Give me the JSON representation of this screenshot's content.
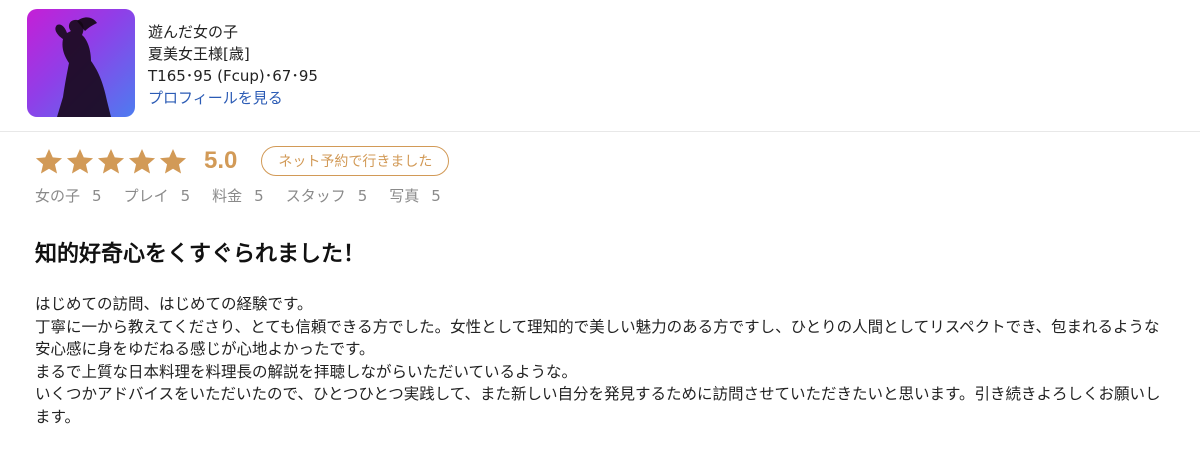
{
  "profile": {
    "caption": "遊んだ女の子",
    "name": "夏美女王様[歳]",
    "measurements": "T165･95 (Fcup)･67･95",
    "profile_link": "プロフィールを見る"
  },
  "rating": {
    "stars": 5,
    "score": "5.0",
    "badge": "ネット予約で行きました",
    "star_color": "#d29a57",
    "categories": [
      {
        "label": "女の子",
        "value": "5"
      },
      {
        "label": "プレイ",
        "value": "5"
      },
      {
        "label": "料金",
        "value": "5"
      },
      {
        "label": "スタッフ",
        "value": "5"
      },
      {
        "label": "写真",
        "value": "5"
      }
    ]
  },
  "review": {
    "title": "知的好奇心をくすぐられました！",
    "lines": [
      "はじめての訪問、はじめての経験です。",
      "丁寧に一から教えてくださり、とても信頼できる方でした。女性として理知的で美しい魅力のある方ですし、ひとりの人間としてリスペクトでき、包まれるような安心感に身をゆだねる感じが心地よかったです。",
      "まるで上質な日本料理を料理長の解説を拝聴しながらいただいているような。",
      "いくつかアドバイスをいただいたので、ひとつひとつ実践して、また新しい自分を発見するために訪問させていただきたいと思います。引き続きよろしくお願いします。"
    ]
  }
}
